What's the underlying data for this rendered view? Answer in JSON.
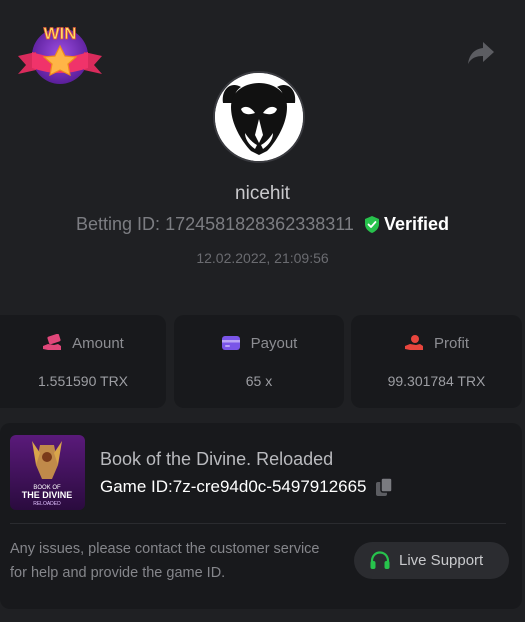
{
  "badge": {
    "text": "WIN"
  },
  "icons": {
    "share": "share-icon",
    "verified": "shield-check-icon",
    "amount": "money-hand-icon",
    "payout": "card-icon",
    "profit": "profit-hand-icon",
    "copy": "copy-icon",
    "support": "headset-icon"
  },
  "colors": {
    "background": "#1f2023",
    "card": "#18191c",
    "verified_green": "#27c24c",
    "amount_icon": "#e0477a",
    "payout_icon": "#7a55e8",
    "profit_icon": "#e8453d",
    "support_green": "#27c24c"
  },
  "user": {
    "username": "nicehit",
    "betting_label": "Betting ID:",
    "betting_id": "1724581828362338311",
    "verified_label": "Verified",
    "datetime": "12.02.2022, 21:09:56"
  },
  "stats": {
    "amount": {
      "label": "Amount",
      "value": "1.551590 TRX"
    },
    "payout": {
      "label": "Payout",
      "value": "65 x"
    },
    "profit": {
      "label": "Profit",
      "value": "99.301784 TRX"
    }
  },
  "game": {
    "title": "Book of the Divine. Reloaded",
    "id_label": "Game ID:",
    "id_value": "7z-cre94d0c-5497912665",
    "thumb_text_top": "BOOK OF",
    "thumb_text_main": "THE DIVINE",
    "thumb_text_sub": "RELOADED"
  },
  "support": {
    "help_text": "Any issues, please contact the customer service for help and provide the game ID.",
    "button_label": "Live Support"
  }
}
